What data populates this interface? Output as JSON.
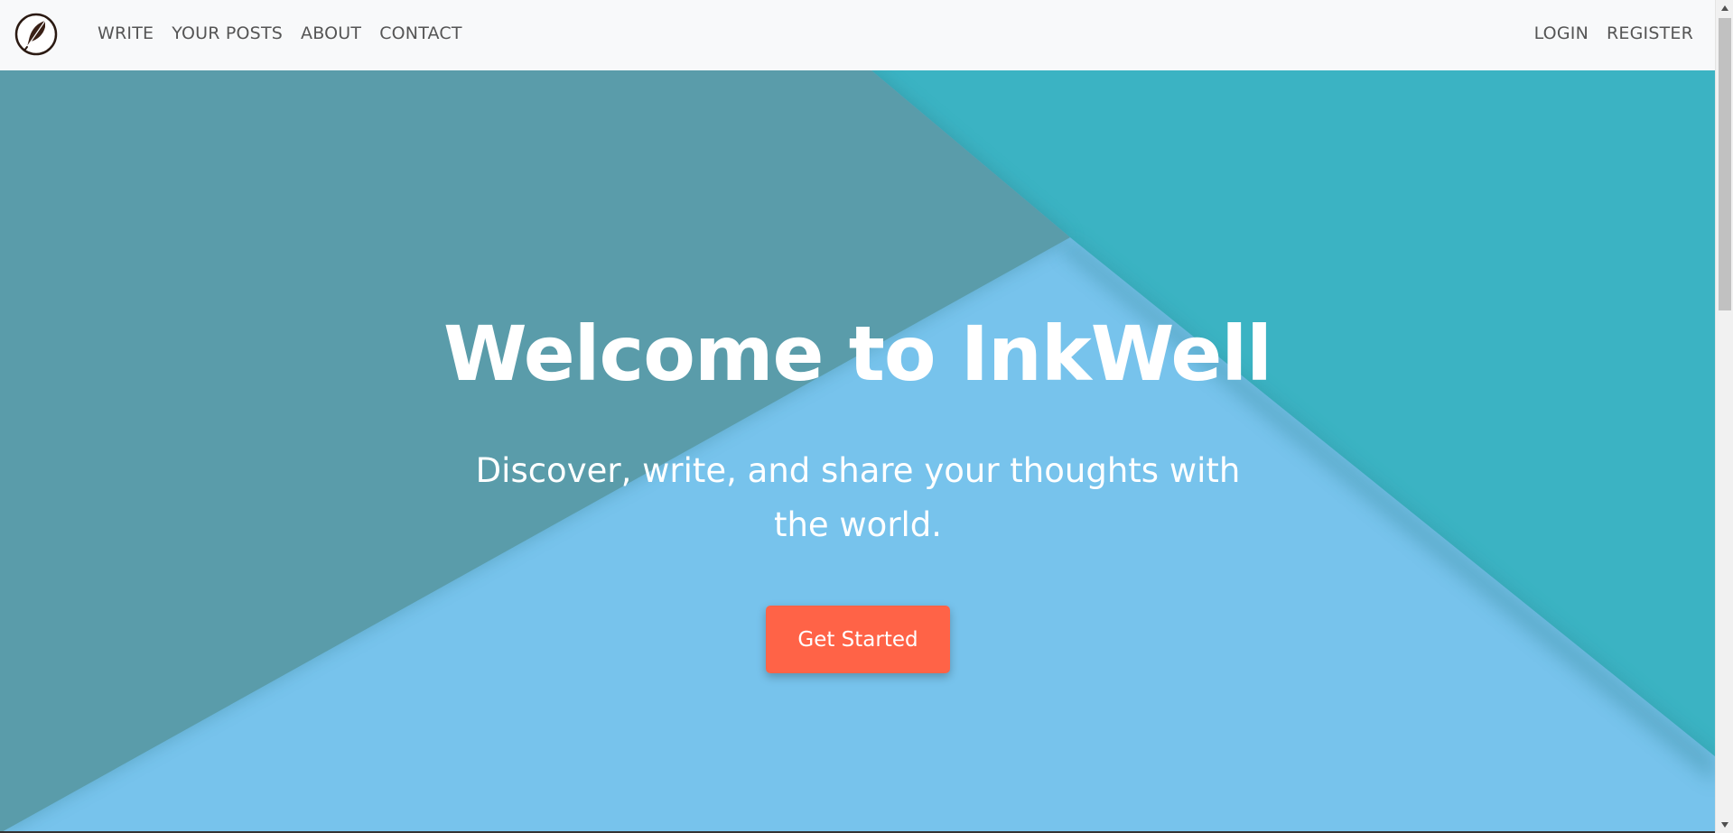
{
  "nav": {
    "logo_icon": "feather-quill-icon",
    "left_links": [
      "WRITE",
      "YOUR POSTS",
      "ABOUT",
      "CONTACT"
    ],
    "right_links": [
      "LOGIN",
      "REGISTER"
    ]
  },
  "hero": {
    "title": "Welcome to InkWell",
    "subtitle": "Discover, write, and share your thoughts with the world.",
    "cta_label": "Get Started"
  },
  "colors": {
    "navbar_bg": "#f8f9fa",
    "hero_light_blue": "#77c3ec",
    "hero_teal": "#3bb3c3",
    "hero_slate": "#5a9caa",
    "cta": "#ff6347"
  }
}
